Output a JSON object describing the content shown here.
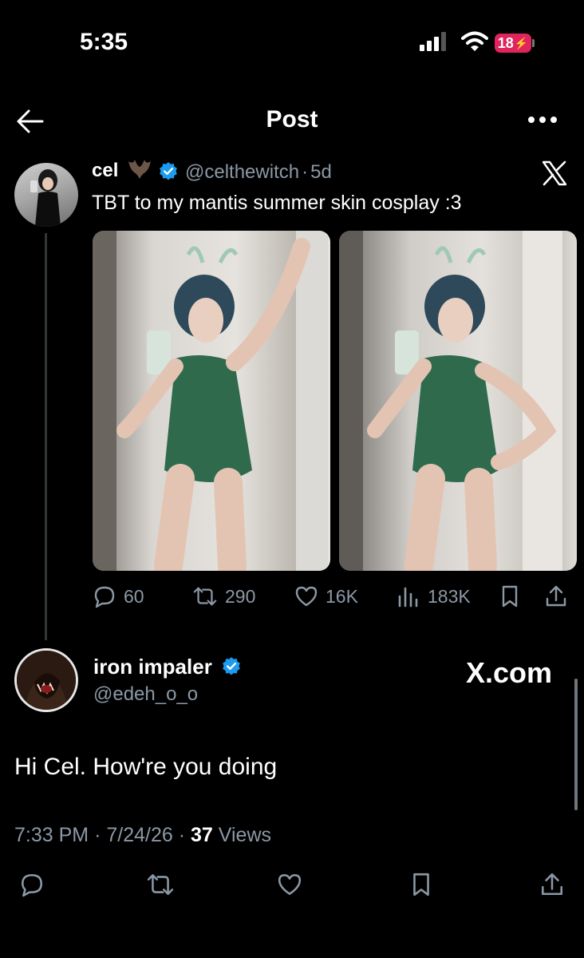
{
  "status_bar": {
    "time": "5:35",
    "battery": "18"
  },
  "header": {
    "title": "Post"
  },
  "quoted_post": {
    "name": "cel",
    "handle": "@celthewitch",
    "age": "5d",
    "separator": "·",
    "text": "TBT to my mantis summer skin cosplay :3",
    "stats": {
      "replies": "60",
      "reposts": "290",
      "likes": "16K",
      "views": "183K"
    }
  },
  "reply_post": {
    "name": "iron impaler",
    "handle": "@edeh_o_o",
    "watermark": "X.com",
    "text": "Hi Cel. How're you doing",
    "time": "7:33 PM",
    "date": "7/24/26",
    "sep": "·",
    "views_count": "37",
    "views_label": "Views"
  },
  "colors": {
    "background": "#000000",
    "text": "#e7e9ea",
    "muted": "#8b98a5",
    "verified": "#1d9bf0",
    "battery": "#e0245e"
  },
  "icons": [
    "back-arrow-icon",
    "more-icon",
    "verified-icon",
    "x-logo-icon",
    "reply-icon",
    "repost-icon",
    "like-icon",
    "views-icon",
    "bookmark-icon",
    "share-icon"
  ]
}
